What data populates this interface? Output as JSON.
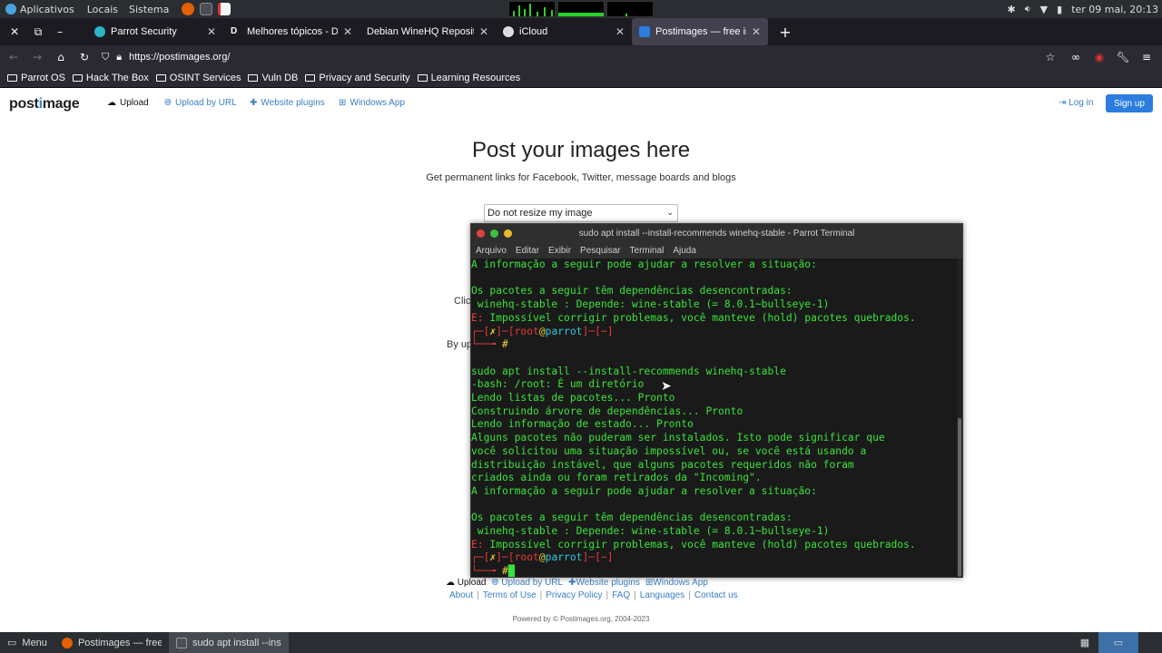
{
  "system_panel": {
    "menu_apps": "Aplicativos",
    "menu_places": "Locais",
    "menu_system": "Sistema",
    "datetime": "ter 09 mai, 20:13"
  },
  "tabs": [
    {
      "title": "Parrot Security",
      "icon": "parrot-favicon"
    },
    {
      "title": "Melhores tópicos - Diolinux",
      "icon": "diolinux-favicon"
    },
    {
      "title": "Debian WineHQ Repository",
      "icon": "none"
    },
    {
      "title": "iCloud",
      "icon": "apple-favicon"
    },
    {
      "title": "Postimages — free image",
      "icon": "postimages-favicon"
    }
  ],
  "navbar": {
    "url": "https://postimages.org/"
  },
  "bookmarks": [
    "Parrot OS",
    "Hack The Box",
    "OSINT Services",
    "Vuln DB",
    "Privacy and Security",
    "Learning Resources"
  ],
  "page": {
    "logo": "postimage",
    "nav_upload": "Upload",
    "nav_upload_url": "Upload by URL",
    "nav_plugins": "Website plugins",
    "nav_windows": "Windows App",
    "login": "Log in",
    "signup": "Sign up",
    "hero_title": "Post your images here",
    "hero_sub": "Get permanent links for Facebook, Twitter, message boards and blogs",
    "resize_value": "Do not resize my image",
    "partial_click": "Clic",
    "partial_by": "By up",
    "footer": {
      "upload": "Upload",
      "upload_url": "Upload by URL",
      "plugins": "Website plugins",
      "windows": "Windows App",
      "links": [
        "About",
        "Terms of Use",
        "Privacy Policy",
        "FAQ",
        "Languages",
        "Contact us"
      ],
      "powered": "Powered by © Postimages.org, 2004-2023"
    }
  },
  "terminal": {
    "title": "sudo apt install --install-recommends winehq-stable - Parrot Terminal",
    "menu": [
      "Arquivo",
      "Editar",
      "Exibir",
      "Pesquisar",
      "Terminal",
      "Ajuda"
    ],
    "lines": {
      "l1": "A informação a seguir pode ajudar a resolver a situação:",
      "l2": "Os pacotes a seguir têm dependências desencontradas:",
      "l3": " winehq-stable : Depende: wine-stable (= 8.0.1~bullseye-1)",
      "l4_err": "E:",
      "l4": " Impossível corrigir problemas, você manteve (hold) pacotes quebrados.",
      "prompt_user": "root",
      "prompt_host": "parrot",
      "prompt_x": "✗",
      "prompt_dir": "~",
      "l6": "sudo apt install --install-recommends winehq-stable",
      "l7": "-bash: /root: É um diretório",
      "l8": "Lendo listas de pacotes... Pronto",
      "l9": "Construindo árvore de dependências... Pronto",
      "l10": "Lendo informação de estado... Pronto",
      "l11": "Alguns pacotes não puderam ser instalados. Isto pode significar que",
      "l12": "você solicitou uma situação impossível ou, se você está usando a",
      "l13": "distribuição instável, que alguns pacotes requeridos não foram",
      "l14": "criados ainda ou foram retirados da \"Incoming\"."
    }
  },
  "taskbar": {
    "menu": "Menu",
    "task1": "Postimages — free im...",
    "task2": "sudo apt install --instal..."
  },
  "colors": {
    "terminal_green": "#3ae33a",
    "terminal_red": "#e83a3a",
    "accent_blue": "#2b7de0"
  }
}
